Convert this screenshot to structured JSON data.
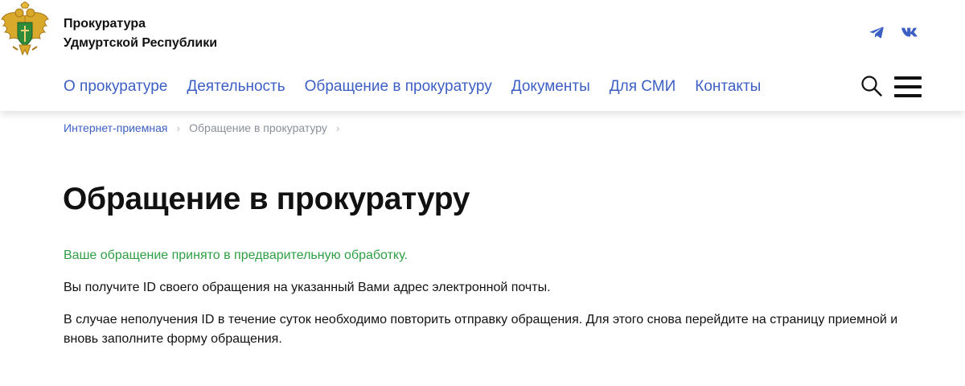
{
  "header": {
    "org_name_line1": "Прокуратура",
    "org_name_line2": "Удмуртской Республики",
    "emblem_icon": "double-headed-eagle-emblem",
    "social": [
      {
        "icon": "telegram-icon",
        "color": "#3d5fc4"
      },
      {
        "icon": "vk-icon",
        "color": "#3d5fc4"
      }
    ]
  },
  "nav": {
    "items": [
      {
        "label": "О прокуратуре"
      },
      {
        "label": "Деятельность"
      },
      {
        "label": "Обращение в прокуратуру"
      },
      {
        "label": "Документы"
      },
      {
        "label": "Для СМИ"
      },
      {
        "label": "Контакты"
      }
    ],
    "search_icon": "search-icon",
    "menu_icon": "hamburger-menu-icon"
  },
  "breadcrumb": {
    "items": [
      {
        "label": "Интернет-приемная"
      },
      {
        "label": "Обращение в прокуратуру"
      }
    ]
  },
  "page": {
    "title": "Обращение в прокуратуру",
    "success_message": "Ваше обращение принято в предварительную обработку.",
    "info_message": "Вы получите ID своего обращения на указанный Вами адрес электронной почты.",
    "repeat_message": "В случае неполучения ID в течение суток необходимо повторить отправку обращения. Для этого снова перейдите на страницу приемной и вновь заполните форму обращения."
  },
  "colors": {
    "link": "#3d5fc4",
    "success": "#2f9e44",
    "breadcrumb_current": "#8a8f98",
    "text": "#111111"
  }
}
